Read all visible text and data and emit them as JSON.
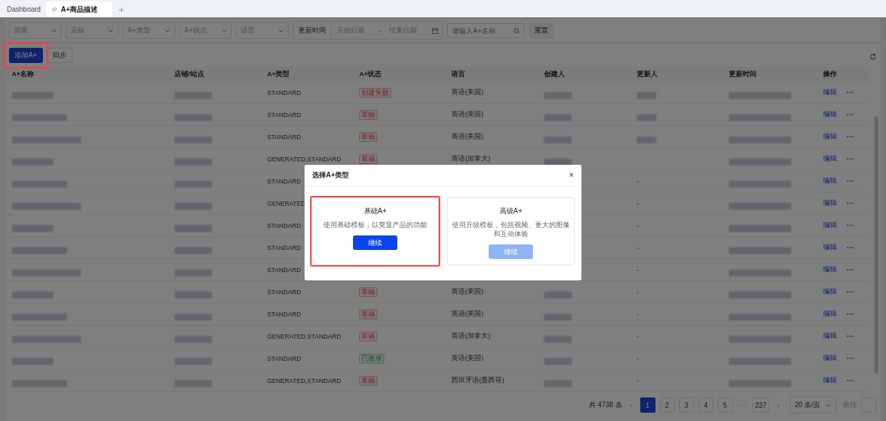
{
  "tabs": [
    {
      "label": "Dashboard",
      "selected": false,
      "pinned": false
    },
    {
      "label": "A+商品描述",
      "selected": true,
      "pinned": true
    }
  ],
  "filters": {
    "selects": [
      "国家",
      "店铺",
      "A+类型",
      "A+状态",
      "语言"
    ],
    "date_label": "更新时间",
    "date_start": "开始日期",
    "date_sep": "-",
    "date_end": "结束日期",
    "search_placeholder": "请输入A+名称",
    "reset": "重置"
  },
  "toolbar": {
    "add_button": {
      "label": "添加A+",
      "highlighted": true
    },
    "sync_button": "同步"
  },
  "table": {
    "columns": [
      "A+名称",
      "店铺/站点",
      "A+类型",
      "A+状态",
      "语言",
      "创建人",
      "更新人",
      "更新时间",
      "操作"
    ],
    "rows": [
      {
        "type": "STANDARD",
        "status": {
          "text": "创建失败",
          "kind": "failed"
        },
        "language": "英语(美国)",
        "creator_redacted": true,
        "updater_redacted": true,
        "action": "编辑"
      },
      {
        "type": "STANDARD",
        "status": {
          "text": "草稿",
          "kind": "draft"
        },
        "language": "英语(美国)",
        "creator_redacted": true,
        "updater_redacted": true,
        "action": "编辑"
      },
      {
        "type": "STANDARD",
        "status": {
          "text": "草稿",
          "kind": "draft"
        },
        "language": "英语(美国)",
        "creator_redacted": true,
        "updater_redacted": true,
        "action": "编辑"
      },
      {
        "type": "GENERATED,STANDARD",
        "status": {
          "text": "草稿",
          "kind": "draft"
        },
        "language": "英语(加拿大)",
        "creator_redacted": true,
        "action": "编辑"
      },
      {
        "type": "STANDARD",
        "updater": "-",
        "action": "编辑"
      },
      {
        "type": "GENERATED",
        "updater": "-",
        "action": "编辑"
      },
      {
        "type": "STANDARD",
        "updater": "-",
        "action": "编辑"
      },
      {
        "type": "STANDARD",
        "updater": "-",
        "action": "编辑"
      },
      {
        "type": "STANDARD",
        "updater": "-",
        "action": "编辑"
      },
      {
        "type": "STANDARD",
        "status": {
          "text": "草稿",
          "kind": "draft"
        },
        "language": "英语(美国)",
        "creator_redacted": true,
        "updater": "-",
        "action": "编辑"
      },
      {
        "type": "STANDARD",
        "status": {
          "text": "草稿",
          "kind": "draft"
        },
        "language": "英语(美国)",
        "creator_redacted": true,
        "updater": "-",
        "action": "编辑"
      },
      {
        "type": "GENERATED,STANDARD",
        "status": {
          "text": "草稿",
          "kind": "draft"
        },
        "language": "英语(加拿大)",
        "creator_redacted": true,
        "updater": "-",
        "action": "编辑"
      },
      {
        "type": "STANDARD",
        "status": {
          "text": "已批准",
          "kind": "approved"
        },
        "language": "英语(美国)",
        "creator_redacted": true,
        "updater": "-",
        "action": "编辑"
      },
      {
        "type": "GENERATED,STANDARD",
        "status": {
          "text": "草稿",
          "kind": "draft"
        },
        "language": "西班牙语(墨西哥)",
        "creator_redacted": true,
        "updater": "-",
        "action": "编辑"
      }
    ]
  },
  "pagination": {
    "total": "共 4738 条",
    "prev": "‹",
    "pages": [
      {
        "label": "1",
        "selected": true
      },
      {
        "label": "2",
        "selected": false
      },
      {
        "label": "3",
        "selected": false
      },
      {
        "label": "4",
        "selected": false
      },
      {
        "label": "5",
        "selected": false
      },
      {
        "label": "···",
        "selected": false
      },
      {
        "label": "237",
        "selected": false
      }
    ],
    "next": "›",
    "page_size": "20 条/页",
    "goto_label": "前往"
  },
  "dialog": {
    "title": "选择A+类型",
    "close": "×",
    "options": [
      {
        "title": "基础A+",
        "description": "使用基础模板，以突显产品的功能",
        "button": "继续",
        "disabled": false,
        "highlighted": true
      },
      {
        "title": "高级A+",
        "description": "使用升级模板，包括视频、更大的图像和互动体验",
        "button": "继续",
        "disabled": true,
        "highlighted": false
      }
    ]
  }
}
